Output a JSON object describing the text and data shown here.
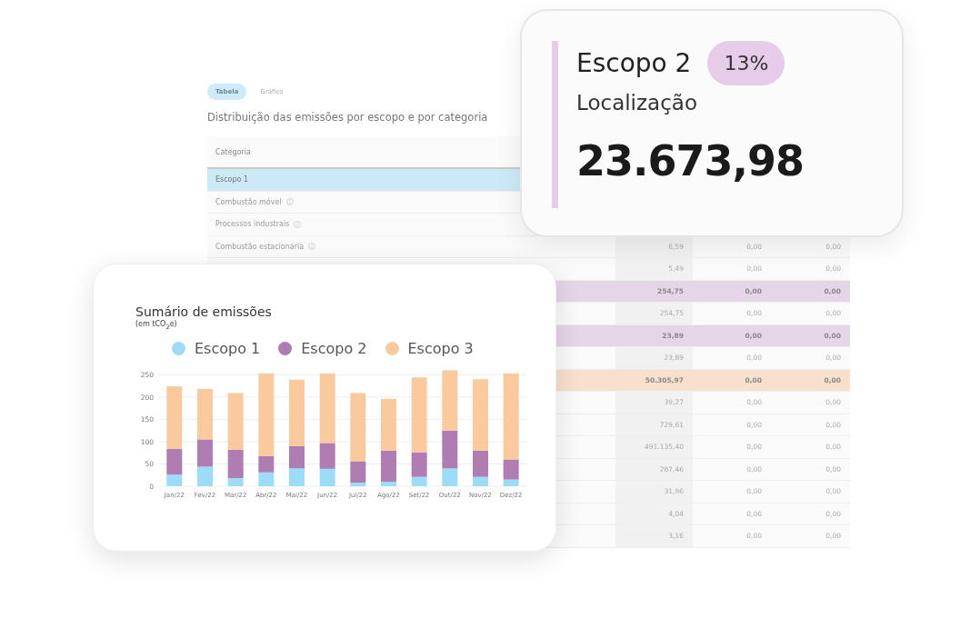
{
  "tabs": [
    {
      "label": "Tabela",
      "selected": true
    },
    {
      "label": "Gráfico",
      "selected": false
    }
  ],
  "section_title": "Distribuição das emissões por escopo e por categoria",
  "table": {
    "columns": [
      "Categoria"
    ],
    "rows": [
      {
        "kind": "scope",
        "color": "#cde9f8",
        "label": "Escopo 1"
      },
      {
        "kind": "category",
        "label": "Combustão móvel",
        "info": true
      },
      {
        "kind": "category",
        "label": "Processos industrais",
        "info": true
      },
      {
        "kind": "category",
        "label": "Combustão estacionária",
        "info": true,
        "values": [
          "6,59",
          "0,00",
          "0,00"
        ]
      },
      {
        "kind": "category",
        "values": [
          "5,49",
          "0,00",
          "0,00"
        ]
      },
      {
        "kind": "scope",
        "color": "#e6d4e9",
        "values": [
          "254,75",
          "0,00",
          "0,00"
        ]
      },
      {
        "kind": "category",
        "values": [
          "254,75",
          "0,00",
          "0,00"
        ]
      },
      {
        "kind": "scope",
        "color": "#e6d4e9",
        "values": [
          "23,89",
          "0,00",
          "0,00"
        ]
      },
      {
        "kind": "category",
        "values": [
          "23,89",
          "0,00",
          "0,00"
        ]
      },
      {
        "kind": "scope",
        "color": "#f9e0cc",
        "values": [
          "50.305,97",
          "0,00",
          "0,00"
        ]
      },
      {
        "kind": "category",
        "values": [
          "39,27",
          "0,00",
          "0,00"
        ]
      },
      {
        "kind": "category",
        "values": [
          "729,61",
          "0,00",
          "0,00"
        ]
      },
      {
        "kind": "category",
        "values": [
          "491.135,40",
          "0,00",
          "0,00"
        ]
      },
      {
        "kind": "category",
        "values": [
          "287,46",
          "0,00",
          "0,00"
        ]
      },
      {
        "kind": "category",
        "values": [
          "31,96",
          "0,00",
          "0,00"
        ]
      },
      {
        "kind": "category",
        "values": [
          "4,04",
          "0,00",
          "0,00"
        ]
      },
      {
        "kind": "category",
        "values": [
          "3,16",
          "0,00",
          "0,00"
        ]
      }
    ]
  },
  "summary": {
    "title": "Sumário de emissões",
    "subtitle": "(em tCO$_{2}$e)",
    "chart_data": {
      "type": "bar",
      "stacked": true,
      "categories": [
        "Jan/22",
        "Fev/22",
        "Mar/22",
        "Abr/22",
        "Mai/22",
        "Jun/22",
        "Jul/22",
        "Ago/22",
        "Set/22",
        "Out/22",
        "Nov/22",
        "Dez/22"
      ],
      "series": [
        {
          "name": "Escopo 1",
          "color": "#9ddcf8",
          "values": [
            26,
            44,
            18,
            31,
            40,
            39,
            8,
            10,
            21,
            40,
            21,
            15
          ]
        },
        {
          "name": "Escopo 2",
          "color": "#b07db3",
          "values": [
            58,
            61,
            64,
            37,
            50,
            58,
            48,
            70,
            55,
            85,
            59,
            45
          ]
        },
        {
          "name": "Escopo 3",
          "color": "#fac99d",
          "values": [
            140,
            113,
            127,
            185,
            149,
            156,
            153,
            116,
            168,
            135,
            160,
            193
          ]
        }
      ],
      "ylim": [
        0,
        265
      ],
      "yticks": [
        0,
        50,
        100,
        150,
        200,
        250
      ],
      "grid": true
    }
  },
  "scope_card": {
    "title": "Escopo 2",
    "badge": "13%",
    "subtitle": "Localização",
    "value": "23.673,98"
  }
}
